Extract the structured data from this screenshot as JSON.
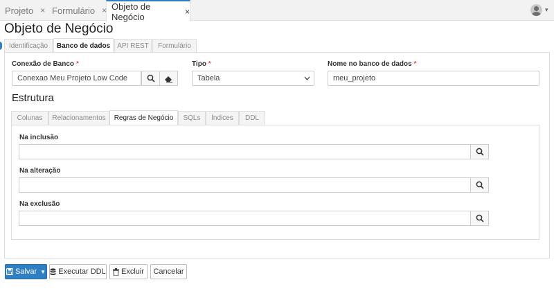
{
  "window_tabs": [
    {
      "label": "Projeto",
      "close": "×"
    },
    {
      "label": "Formulário",
      "close": "×"
    },
    {
      "label": "Objeto de Negócio",
      "close": "×",
      "active": true
    }
  ],
  "page_title": "Objeto de Negócio",
  "main_tabs": [
    {
      "label": "Identificação"
    },
    {
      "label": "Banco de dados",
      "active": true
    },
    {
      "label": "API REST"
    },
    {
      "label": "Formulário"
    }
  ],
  "fields": {
    "connection": {
      "label": "Conexão de Banco",
      "required_mark": "*",
      "value": "Conexao Meu Projeto Low Code"
    },
    "type": {
      "label": "Tipo",
      "required_mark": "*",
      "value": "Tabela"
    },
    "db_name": {
      "label": "Nome no banco de dados",
      "required_mark": "*",
      "value": "meu_projeto"
    }
  },
  "section_title": "Estrutura",
  "sub_tabs": [
    {
      "label": "Colunas"
    },
    {
      "label": "Relacionamentos"
    },
    {
      "label": "Regras de Negócio",
      "active": true
    },
    {
      "label": "SQLs"
    },
    {
      "label": "Índices"
    },
    {
      "label": "DDL"
    }
  ],
  "rules": [
    {
      "label": "Na inclusão",
      "value": ""
    },
    {
      "label": "Na alteração",
      "value": ""
    },
    {
      "label": "Na exclusão",
      "value": ""
    }
  ],
  "footer": {
    "save": "Salvar",
    "execute_ddl": "Executar DDL",
    "delete": "Excluir",
    "cancel": "Cancelar"
  },
  "colors": {
    "accent": "#2f7fc4",
    "required": "#d9534f"
  },
  "icons": {
    "close": "close-icon",
    "search": "search-icon",
    "eraser": "eraser-icon",
    "select": "chevron-down-icon",
    "save": "floppy-disk-icon",
    "database": "database-icon",
    "trash": "trash-icon",
    "user": "user-avatar-icon"
  }
}
